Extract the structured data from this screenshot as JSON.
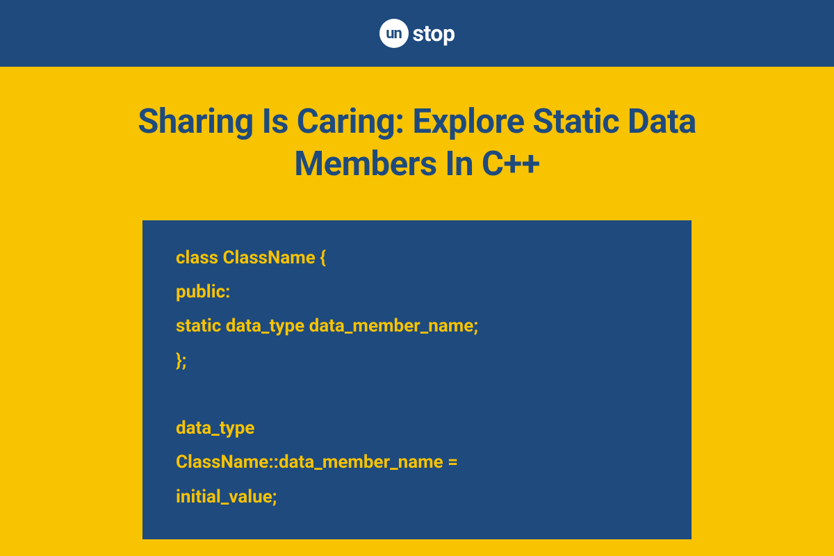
{
  "header": {
    "logo_prefix": "un",
    "logo_suffix": "stop"
  },
  "main": {
    "title": "Sharing Is Caring: Explore Static Data Members In C++",
    "code": {
      "line1": "class ClassName {",
      "line2": "public:",
      "line3": "static data_type data_member_name;",
      "line4": "};",
      "line5": "data_type",
      "line6": "ClassName::data_member_name =",
      "line7": "initial_value;"
    }
  },
  "colors": {
    "navy": "#1e4a7e",
    "yellow": "#f8c300",
    "white": "#ffffff"
  }
}
